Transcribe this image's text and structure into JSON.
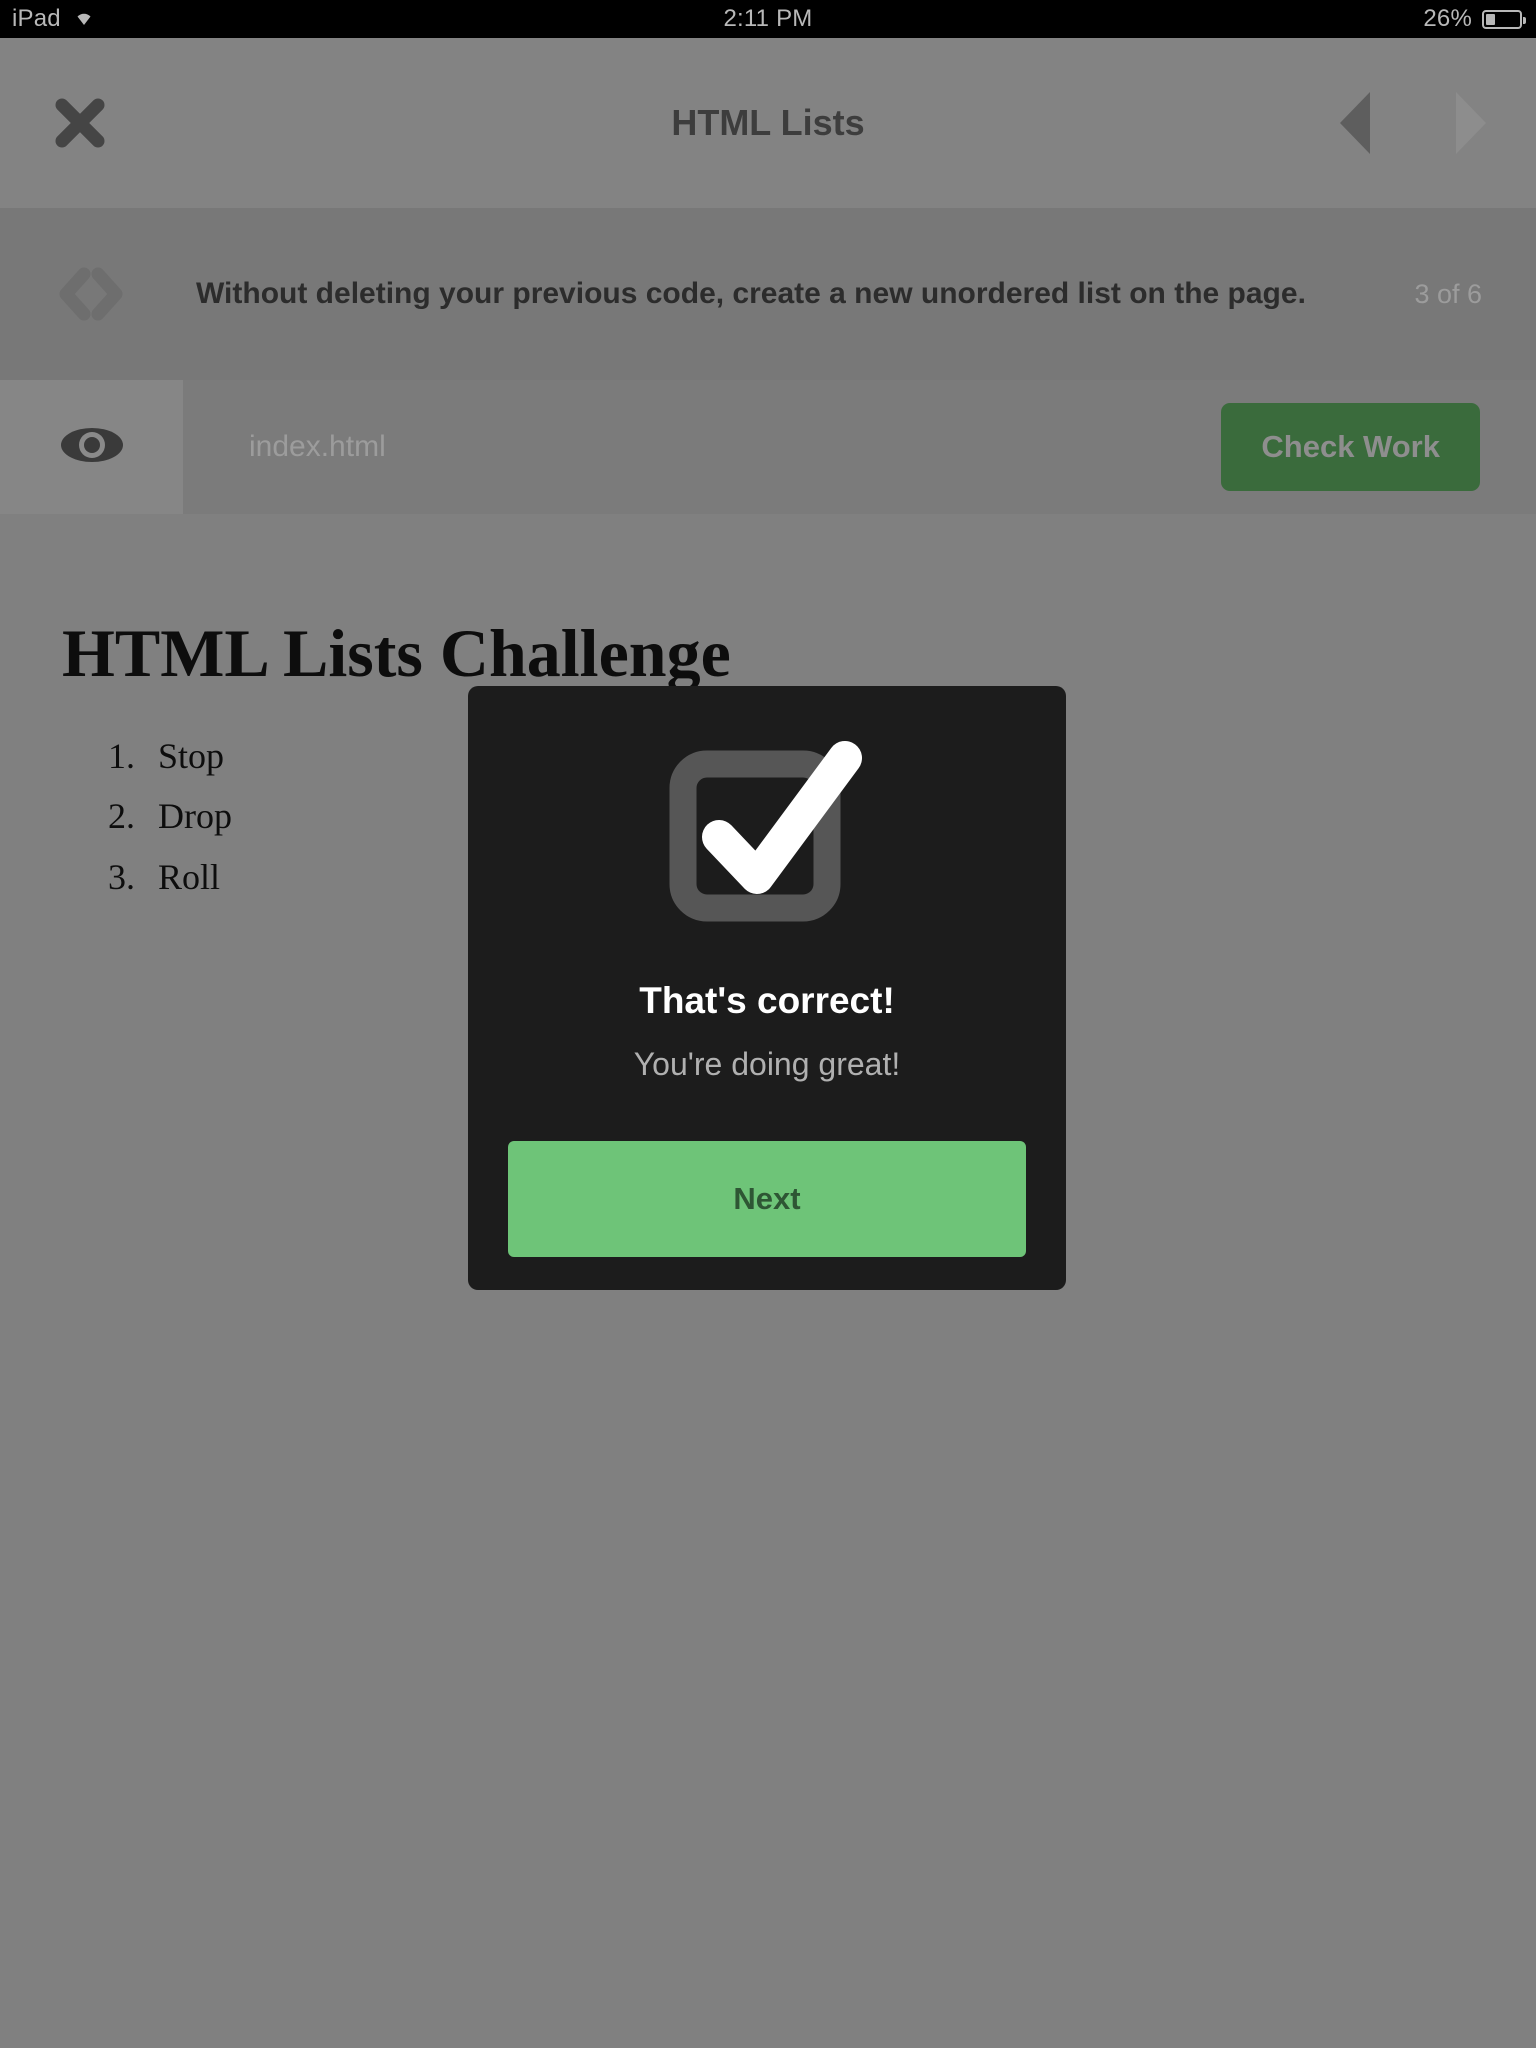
{
  "statusbar": {
    "device": "iPad",
    "wifi_icon": "wifi-icon",
    "time": "2:11 PM",
    "battery_percent": "26%",
    "battery_icon": "battery-low-icon",
    "battery_level": 26
  },
  "header": {
    "close_icon": "close-icon",
    "title": "HTML Lists",
    "prev_icon": "arrow-left-icon",
    "next_icon": "arrow-right-icon",
    "prev_enabled": true,
    "next_enabled": false
  },
  "instruction": {
    "code_icon": "code-brackets-icon",
    "text": "Without deleting your previous code, create a new unordered list on the page.",
    "step_counter": "3 of 6",
    "current_step": 3,
    "total_steps": 6
  },
  "toolbar": {
    "preview_icon": "eye-icon",
    "file_name": "index.html",
    "check_work_label": "Check Work"
  },
  "preview": {
    "heading": "HTML Lists Challenge",
    "list_type": "ordered",
    "list_items": [
      "Stop",
      "Drop",
      "Roll"
    ]
  },
  "modal": {
    "icon": "checkbox-checked-icon",
    "title": "That's correct!",
    "subtitle": "You're doing great!",
    "next_label": "Next"
  },
  "colors": {
    "statusbar_bg": "#000000",
    "statusbar_text": "#b8b8b8",
    "header_bg": "#838383",
    "instruction_bg": "#787878",
    "toolbar_bg": "#7d7d7d",
    "preview_bg": "#808080",
    "check_work_green": "#3a6b3c",
    "modal_bg": "#1c1c1c",
    "next_green": "#6ec478",
    "next_text": "#2e5634"
  }
}
